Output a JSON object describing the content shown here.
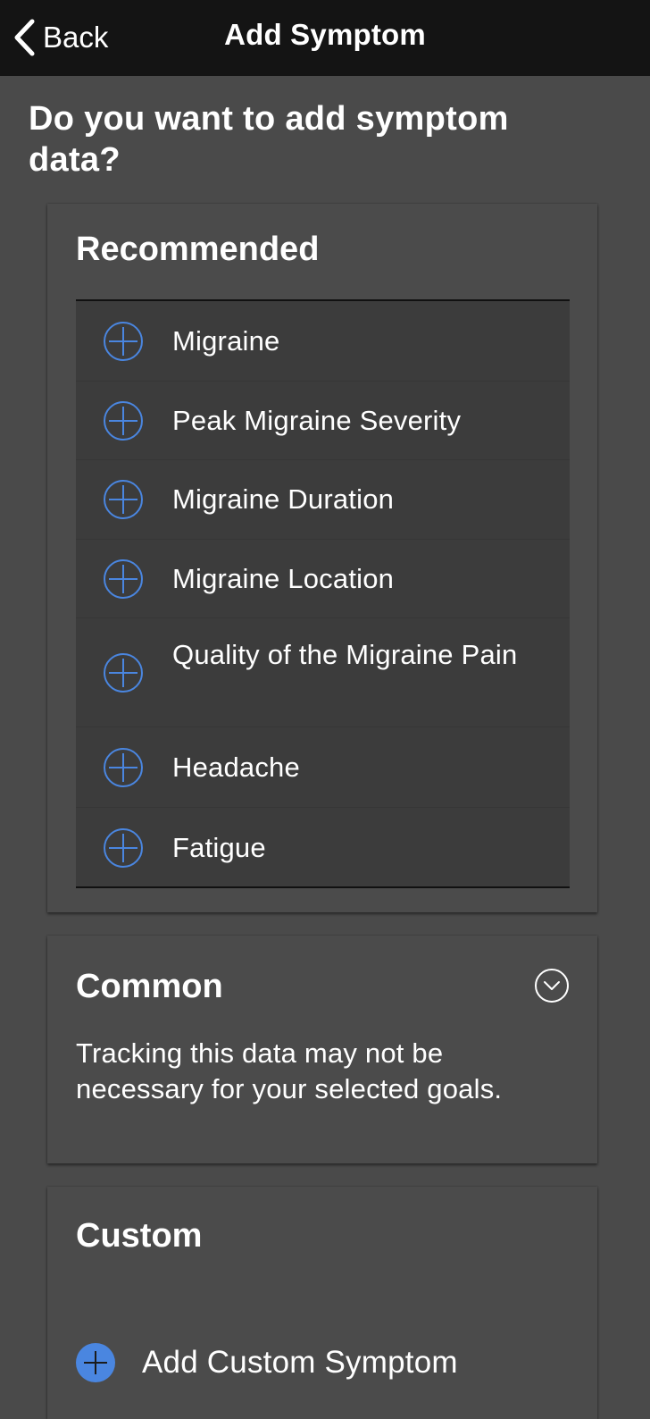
{
  "header": {
    "back_label": "Back",
    "title": "Add Symptom"
  },
  "question": "Do you want to add symptom data?",
  "recommended": {
    "heading": "Recommended",
    "items": [
      {
        "label": "Migraine",
        "icon": "plus-circle-outline-icon"
      },
      {
        "label": "Peak Migraine Severity",
        "icon": "plus-circle-outline-icon"
      },
      {
        "label": "Migraine Duration",
        "icon": "plus-circle-outline-icon"
      },
      {
        "label": "Migraine Location",
        "icon": "plus-circle-outline-icon"
      },
      {
        "label": "Quality of the Migraine Pain",
        "icon": "plus-circle-outline-icon"
      },
      {
        "label": "Headache",
        "icon": "plus-circle-outline-icon"
      },
      {
        "label": "Fatigue",
        "icon": "plus-circle-outline-icon"
      }
    ]
  },
  "common": {
    "heading": "Common",
    "description": "Tracking this data may not be necessary for your selected goals.",
    "toggle_icon": "chevron-down-circle-icon"
  },
  "custom": {
    "heading": "Custom",
    "add_label": "Add Custom Symptom",
    "add_icon": "plus-circle-filled-icon"
  },
  "colors": {
    "accent": "#4a86e0",
    "navbar": "#141414",
    "background": "#4a4a4a",
    "list_background": "#3c3c3c"
  }
}
